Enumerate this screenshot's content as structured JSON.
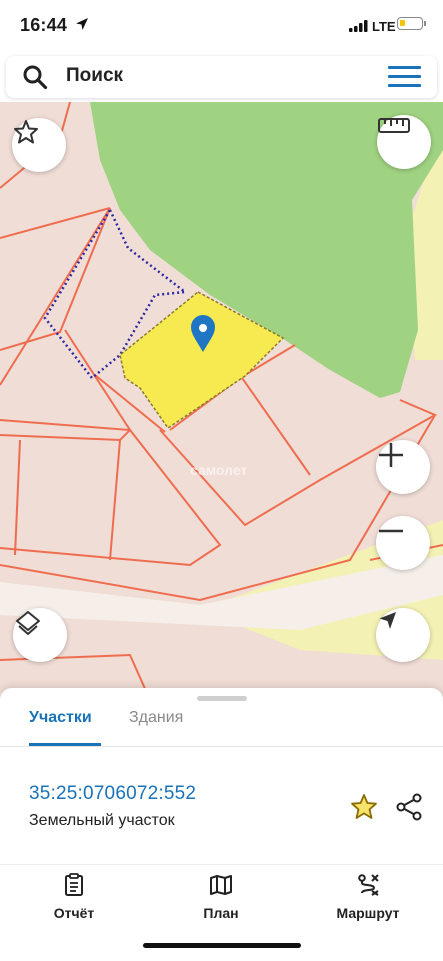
{
  "status_bar": {
    "time": "16:44",
    "network": "LTE",
    "battery_color": "#f5c400"
  },
  "search": {
    "placeholder": "Поиск",
    "icon": "search-icon",
    "menu_icon": "hamburger-menu-icon"
  },
  "map": {
    "buttons": [
      "favorites-star-icon",
      "ruler-icon",
      "zoom-in-icon",
      "zoom-out-icon",
      "layers-icon",
      "my-location-icon"
    ],
    "watermark": "самолет",
    "colors": {
      "parcel_fill": "#f2d6cf",
      "parcel_border": "#ef6d4f",
      "selected_fill": "#f6ea50",
      "forest": "#9fd281",
      "field": "#f3f1b4",
      "dotted_border": "#2b2aa5",
      "marker": "#1f76c5"
    }
  },
  "sheet": {
    "tabs": [
      {
        "label": "Участки",
        "active": true
      },
      {
        "label": "Здания",
        "active": false
      }
    ],
    "parcel": {
      "cadastral_number": "35:25:0706072:552",
      "type": "Земельный участок"
    },
    "accent": "#1a72b8",
    "favorite_color": "#e3b51e"
  },
  "bottom_nav": [
    {
      "label": "Отчёт",
      "icon": "report-icon"
    },
    {
      "label": "План",
      "icon": "map-plan-icon"
    },
    {
      "label": "Маршрут",
      "icon": "route-icon"
    }
  ]
}
